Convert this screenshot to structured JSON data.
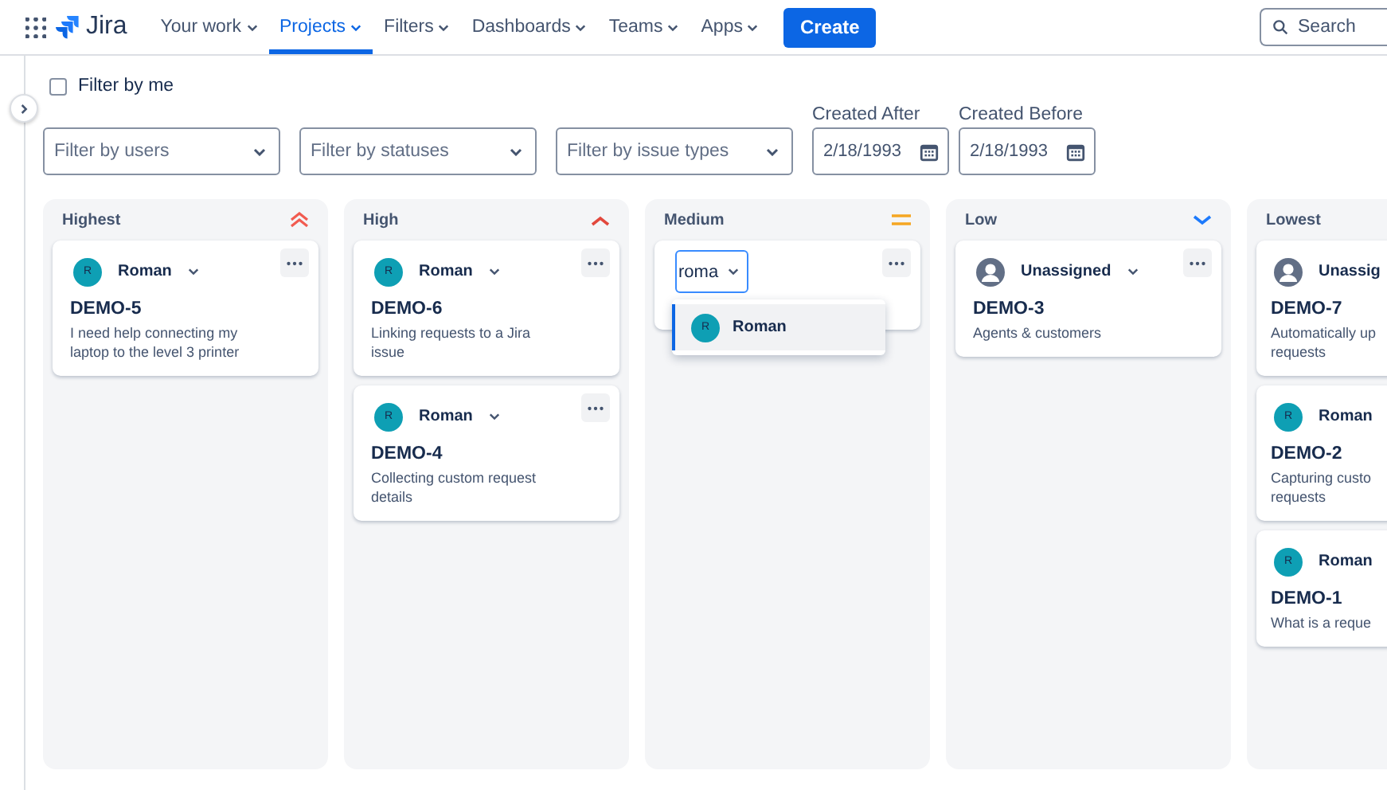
{
  "nav": {
    "logo": "Jira",
    "items": [
      {
        "label": "Your work",
        "selected": false
      },
      {
        "label": "Projects",
        "selected": true
      },
      {
        "label": "Filters",
        "selected": false
      },
      {
        "label": "Dashboards",
        "selected": false
      },
      {
        "label": "Teams",
        "selected": false
      },
      {
        "label": "Apps",
        "selected": false
      }
    ],
    "create": "Create",
    "search": {
      "placeholder": "Search"
    }
  },
  "filters": {
    "filter_by_me": {
      "label": "Filter by me",
      "checked": false
    },
    "selects": [
      {
        "placeholder": "Filter by users"
      },
      {
        "placeholder": "Filter by statuses"
      },
      {
        "placeholder": "Filter by issue types"
      }
    ],
    "dates": [
      {
        "label": "Created After",
        "value": "2/18/1993"
      },
      {
        "label": "Created Before",
        "value": "2/18/1993"
      }
    ]
  },
  "columns": [
    {
      "title": "Highest",
      "kind": "highest",
      "cut": false,
      "cards": [
        {
          "kind": "issue",
          "assignee": {
            "kind": "user",
            "initial": "R",
            "name": "Roman"
          },
          "key": "DEMO-5",
          "summary": "I need help connecting my laptop to the level 3 printer"
        }
      ]
    },
    {
      "title": "High",
      "kind": "high",
      "cut": false,
      "cards": [
        {
          "kind": "issue",
          "assignee": {
            "kind": "user",
            "initial": "R",
            "name": "Roman"
          },
          "key": "DEMO-6",
          "summary": "Linking requests to a Jira issue"
        },
        {
          "kind": "issue",
          "assignee": {
            "kind": "user",
            "initial": "R",
            "name": "Roman"
          },
          "key": "DEMO-4",
          "summary": "Collecting custom request details"
        }
      ]
    },
    {
      "title": "Medium",
      "kind": "medium",
      "cut": false,
      "cards": [
        {
          "kind": "editing",
          "value": "roma",
          "options": [
            {
              "initial": "R",
              "name": "Roman",
              "selected": true
            }
          ]
        }
      ]
    },
    {
      "title": "Low",
      "kind": "low",
      "cut": false,
      "cards": [
        {
          "kind": "issue",
          "assignee": {
            "kind": "unassigned",
            "name": "Unassigned"
          },
          "key": "DEMO-3",
          "summary": "Agents & customers"
        }
      ]
    },
    {
      "title": "Lowest",
      "kind": "lowest",
      "cut": true,
      "cards": [
        {
          "kind": "issue",
          "assignee": {
            "kind": "unassigned",
            "name": "Unassig"
          },
          "key": "DEMO-7",
          "summary": "Automatically up requests"
        },
        {
          "kind": "issue",
          "assignee": {
            "kind": "user",
            "initial": "R",
            "name": "Roman"
          },
          "key": "DEMO-2",
          "summary": "Capturing custo requests"
        },
        {
          "kind": "issue",
          "assignee": {
            "kind": "user",
            "initial": "R",
            "name": "Roman"
          },
          "key": "DEMO-1",
          "summary": "What is a reque"
        }
      ]
    }
  ]
}
